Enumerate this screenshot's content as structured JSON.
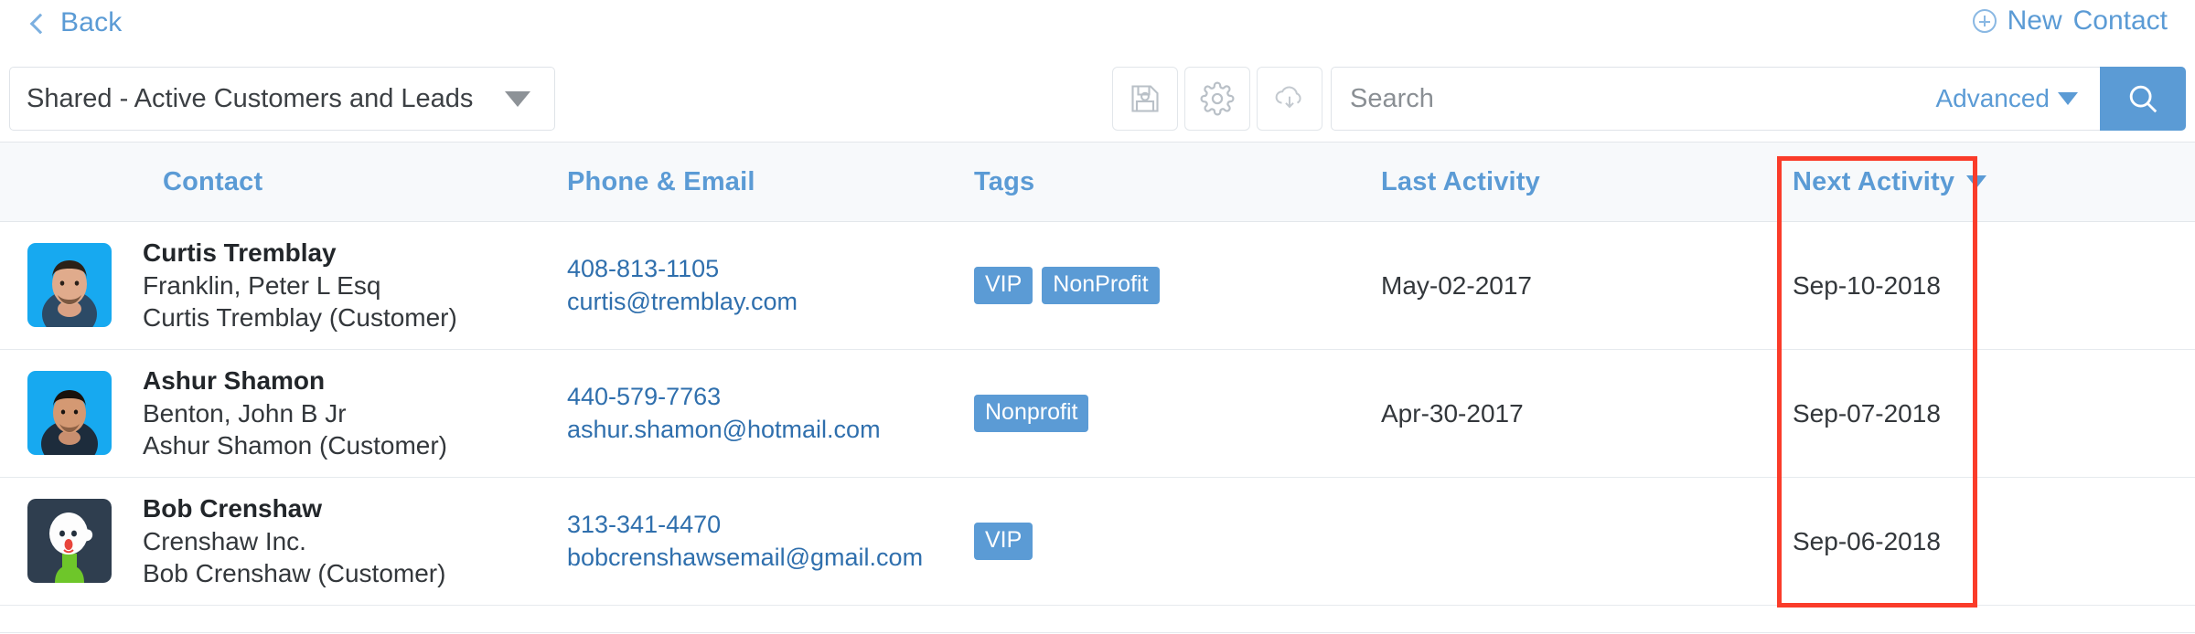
{
  "topbar": {
    "back_label": "Back",
    "back_icon": "chevron-left-icon",
    "new_plus_icon": "plus-circle-icon",
    "new_label": "New",
    "contact_label": "Contact"
  },
  "controls": {
    "view_selector_value": "Shared - Active Customers and Leads",
    "view_selector_caret": "caret-down-icon",
    "buttons": [
      {
        "name": "save-view-button",
        "icon": "floppy-disk-icon"
      },
      {
        "name": "settings-button",
        "icon": "gear-icon"
      },
      {
        "name": "export-download-button",
        "icon": "cloud-download-icon"
      }
    ],
    "search": {
      "placeholder": "Search",
      "value": "",
      "advanced_label": "Advanced",
      "advanced_caret": "caret-down-icon",
      "search_icon": "magnifier-icon"
    }
  },
  "table": {
    "headers": {
      "contact": "Contact",
      "phone_email": "Phone & Email",
      "tags": "Tags",
      "last_activity": "Last Activity",
      "next_activity": "Next Activity",
      "next_activity_sort_icon": "caret-down-icon"
    },
    "rows": [
      {
        "avatar": "photo-avatar-man-blue-background",
        "name": "Curtis Tremblay",
        "company": "Franklin, Peter L Esq",
        "related": "Curtis Tremblay (Customer)",
        "phone": "408-813-1105",
        "email": "curtis@tremblay.com",
        "tags": [
          "VIP",
          "NonProfit"
        ],
        "last_activity": "May-02-2017",
        "next_activity": "Sep-10-2018"
      },
      {
        "avatar": "photo-avatar-man-blue-background",
        "name": "Ashur Shamon",
        "company": "Benton, John B Jr",
        "related": "Ashur Shamon (Customer)",
        "phone": "440-579-7763",
        "email": "ashur.shamon@hotmail.com",
        "tags": [
          "Nonprofit"
        ],
        "last_activity": "Apr-30-2017",
        "next_activity": "Sep-07-2018"
      },
      {
        "avatar": "cartoon-avatar-dark-background",
        "name": "Bob Crenshaw",
        "company": "Crenshaw Inc.",
        "related": "Bob Crenshaw (Customer)",
        "phone": "313-341-4470",
        "email": "bobcrenshawsemail@gmail.com",
        "tags": [
          "VIP"
        ],
        "last_activity": "",
        "next_activity": "Sep-06-2018"
      }
    ]
  },
  "annotation": {
    "highlight_box": "next-activity-column-highlight",
    "color": "#fa3c2a"
  },
  "colors": {
    "accent_blue": "#5b9bd5",
    "link_blue": "#2f6fad",
    "header_bg": "#f7f9fb",
    "text_dark": "#33373b"
  }
}
